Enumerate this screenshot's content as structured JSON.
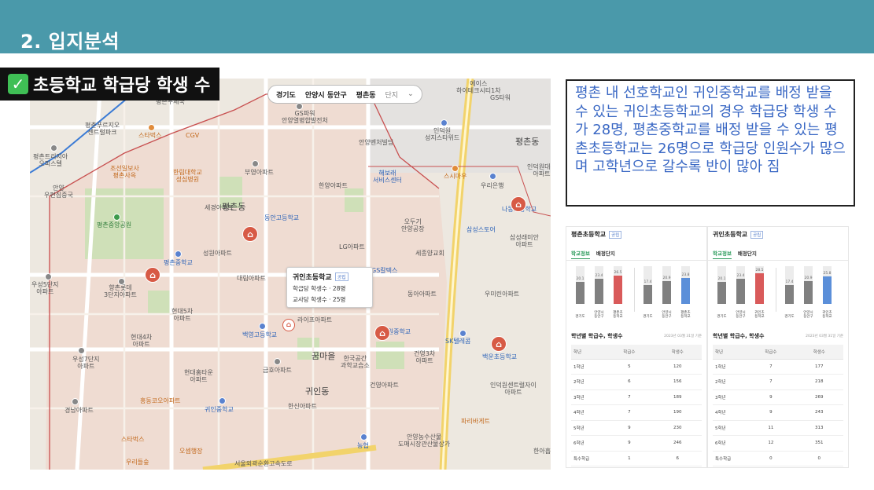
{
  "header": {
    "title": "2. 입지분석"
  },
  "section": {
    "label": "초등학교 학급당 학생 수"
  },
  "map": {
    "breadcrumb": [
      "경기도",
      "안양시 동안구",
      "평촌동",
      "단지"
    ],
    "popup": {
      "title": "귀인초등학교",
      "badge": "공립",
      "line1": "학급당 학생수 · 28명",
      "line2": "교사당 학생수 · 25명"
    },
    "labels": [
      {
        "t": "에이스\n하이테크시티1차"
      },
      {
        "t": "GS타워"
      },
      {
        "t": "평촌우체국"
      },
      {
        "t": "평촌푸르지오\n센트럴파크"
      },
      {
        "t": "스타벅스"
      },
      {
        "t": "CGV"
      },
      {
        "t": "GS파워\n안양열병합발전처"
      },
      {
        "t": "인덕원\n성지스타위드"
      },
      {
        "t": "안양벤처빌딩"
      },
      {
        "t": "평촌동"
      },
      {
        "t": "평촌트리지아\n오피스텔"
      },
      {
        "t": "조선일보사\n평촌사옥"
      },
      {
        "t": "한림대학교\n성심병원"
      },
      {
        "t": "부영아파트"
      },
      {
        "t": "해보래\n서비스센터"
      },
      {
        "t": "스시마우"
      },
      {
        "t": "우리은행"
      },
      {
        "t": "인덕원대우\n아파트"
      },
      {
        "t": "안양\n우편집중국"
      },
      {
        "t": "한양아파트"
      },
      {
        "t": "세경아파트"
      },
      {
        "t": "평촌동"
      },
      {
        "t": "평촌중앙공원"
      },
      {
        "t": "동안고등학교"
      },
      {
        "t": "오두기\n안양공장"
      },
      {
        "t": "나동초등학교"
      },
      {
        "t": "삼성스토어"
      },
      {
        "t": "삼성래미안\n아파트"
      },
      {
        "t": "성원아파트"
      },
      {
        "t": "LG아파트"
      },
      {
        "t": "세종양교회"
      },
      {
        "t": "평촌중학교"
      },
      {
        "t": "대림아파트"
      },
      {
        "t": "GS칼텍스"
      },
      {
        "t": "우성5단지\n아파트"
      },
      {
        "t": "향촌롯데\n3단지아파트"
      },
      {
        "t": "동아아파트"
      },
      {
        "t": "우미린아파트"
      },
      {
        "t": "현대5차\n아파트"
      },
      {
        "t": "라이프아파트"
      },
      {
        "t": "현대4차\n아파트"
      },
      {
        "t": "백영고등학교"
      },
      {
        "t": "인덕원중학교"
      },
      {
        "t": "SK텔레콤"
      },
      {
        "t": "백운초등학교"
      },
      {
        "t": "우성7단지\n아파트"
      },
      {
        "t": "현대홈타운\n아파트"
      },
      {
        "t": "꿈마을"
      },
      {
        "t": "한국공간\n과학교습소"
      },
      {
        "t": "건영3차\n아파트"
      },
      {
        "t": "인덕원센트럴자이\n아파트"
      },
      {
        "t": "금호아파트"
      },
      {
        "t": "귀인동"
      },
      {
        "t": "건영아파트"
      },
      {
        "t": "경남아파트"
      },
      {
        "t": "흥동코오아파트"
      },
      {
        "t": "귀인중학교"
      },
      {
        "t": "한신아파트"
      },
      {
        "t": "파리바게트"
      },
      {
        "t": "스타벅스"
      },
      {
        "t": "오셈행장"
      },
      {
        "t": "우리들숲"
      },
      {
        "t": "안양농수산물\n도매시장관산물상가"
      },
      {
        "t": "농협"
      },
      {
        "t": "서울외곽순환고속도로"
      },
      {
        "t": "한아흡"
      }
    ]
  },
  "description": "평촌 내 선호학교인 귀인중학교를 배정 받을 수 있는 귀인초등학교의 경우 학급당 학생 수가 28명, 평촌중학교를 배정 받을 수 있는 평촌초등학교는 26명으로 학급당 인원수가 많으며 고학년으로 갈수록 반이 많아 짐",
  "schools": [
    {
      "name": "평촌초등학교",
      "badge": "공립",
      "tabs": [
        "학교정보",
        "배정단지"
      ],
      "chart_data": [
        {
          "type": "bar",
          "title": "",
          "categories": [
            "경기도",
            "안양시\n동안구",
            "평촌초\n등학교"
          ],
          "values": [
            20.1,
            23.4,
            26.5
          ],
          "ylim": [
            0,
            35
          ]
        },
        {
          "type": "bar",
          "title": "",
          "categories": [
            "경기도",
            "안양시\n동안구",
            "평촌초\n등학교"
          ],
          "values": [
            17.4,
            20.9,
            23.8
          ],
          "ylim": [
            0,
            35
          ]
        }
      ],
      "colors": {
        "region": "#808080",
        "school_a": "#d95a5a",
        "school_b": "#5b8fd9"
      },
      "table_title": "학년별 학급수, 학생수",
      "table_date": "2023년 03월 31일 기준",
      "columns": [
        "학년",
        "학급수",
        "학생수"
      ],
      "rows": [
        [
          "1학년",
          "5",
          "120"
        ],
        [
          "2학년",
          "6",
          "156"
        ],
        [
          "3학년",
          "7",
          "189"
        ],
        [
          "4학년",
          "7",
          "190"
        ],
        [
          "5학년",
          "9",
          "230"
        ],
        [
          "6학년",
          "9",
          "246"
        ],
        [
          "특수학급",
          "1",
          "6"
        ]
      ]
    },
    {
      "name": "귀인초등학교",
      "badge": "공립",
      "tabs": [
        "학교정보",
        "배정단지"
      ],
      "chart_data": [
        {
          "type": "bar",
          "title": "",
          "categories": [
            "경기도",
            "안양시\n동안구",
            "귀인초\n등학교"
          ],
          "values": [
            20.1,
            23.4,
            28.5
          ],
          "ylim": [
            0,
            35
          ]
        },
        {
          "type": "bar",
          "title": "",
          "categories": [
            "경기도",
            "안양시\n동안구",
            "귀인초\n등학교"
          ],
          "values": [
            17.4,
            20.9,
            25.8
          ],
          "ylim": [
            0,
            35
          ]
        }
      ],
      "colors": {
        "region": "#808080",
        "school_a": "#d95a5a",
        "school_b": "#5b8fd9"
      },
      "table_title": "학년별 학급수, 학생수",
      "table_date": "2023년 03월 31일 기준",
      "columns": [
        "학년",
        "학급수",
        "학생수"
      ],
      "rows": [
        [
          "1학년",
          "7",
          "177"
        ],
        [
          "2학년",
          "7",
          "218"
        ],
        [
          "3학년",
          "9",
          "269"
        ],
        [
          "4학년",
          "9",
          "243"
        ],
        [
          "5학년",
          "11",
          "313"
        ],
        [
          "6학년",
          "12",
          "351"
        ],
        [
          "특수학급",
          "0",
          "0"
        ]
      ]
    }
  ]
}
